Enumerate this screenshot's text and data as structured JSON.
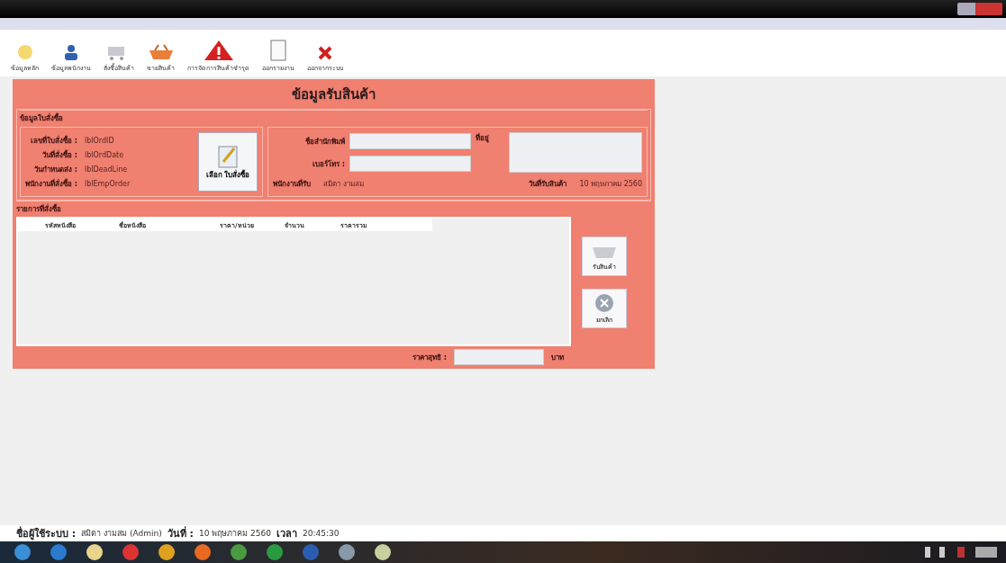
{
  "toolbar": [
    "ข้อมูลหลัก",
    "ข้อมูลพนักงาน",
    "สั่งซื้อสินค้า",
    "ขายสินค้า",
    "การจัดการสินค้าชำรุด",
    "ออกรายงาน",
    "ออกจากระบบ"
  ],
  "heading": "ข้อมูลรับสินค้า",
  "order_group": {
    "title": "ข้อมูลใบสั่งซื้อ",
    "fields": [
      {
        "label": "เลขที่ใบสั่งซื้อ :",
        "value": "lblOrdID"
      },
      {
        "label": "วันที่สั่งซื้อ :",
        "value": "lblOrdDate"
      },
      {
        "label": "วันกำหนดส่ง :",
        "value": "lblDeadLine"
      },
      {
        "label": "พนักงานที่สั่งซื้อ :",
        "value": "lblEmpOrder"
      }
    ],
    "select_button": "เลือก ใบสั่งซื้อ",
    "publisher_label": "ชื่อสำนักพิมพ์",
    "address_label": "ที่อยู่",
    "phone_label": "เบอร์โทร :",
    "receiver_label": "พนักงานที่รับ",
    "receiver": "สมิตา งามสม",
    "date_label": "วันที่รับสินค้า",
    "date": "10 พฤษภาคม 2560"
  },
  "items_group": {
    "title": "รายการที่สั่งซื้อ",
    "columns": [
      "รหัสหนังสือ",
      "ชื่อหนังสือ",
      "ราคา/หน่วย",
      "จำนวน",
      "ราคารวม"
    ],
    "receive_button": "รับสินค้า",
    "cancel_button": "ยกเลิก",
    "total_label": "ราคาสุทธิ :",
    "currency": "บาท"
  },
  "status_bar": {
    "user_label": "ชื่อผู้ใช้ระบบ :",
    "user": "สมิตา งามสม (Admin)",
    "date_label": "วันที่ :",
    "date": "10 พฤษภาคม 2560",
    "time_label": "เวลา",
    "time": "20:45:30"
  }
}
